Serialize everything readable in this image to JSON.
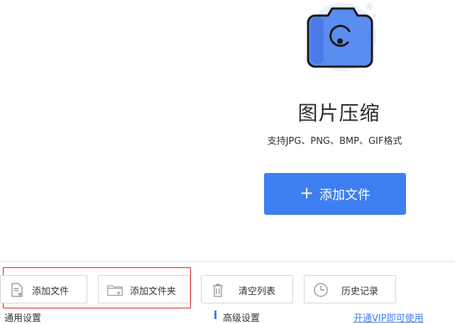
{
  "header": {
    "title": "图片压缩",
    "formats_text": "支持JPG、PNG、BMP、GIF格式",
    "illustration_icon": "camera-icon"
  },
  "primary_action": {
    "label": "添加文件",
    "icon": "plus-icon"
  },
  "toolbar": {
    "add_file": "添加文件",
    "add_folder": "添加文件夹",
    "clear_list": "清空列表",
    "history": "历史记录"
  },
  "sections": {
    "general": "通用设置",
    "advanced": "高级设置",
    "vip_link": "开通VIP即可使用"
  },
  "colors": {
    "accent": "#3d7ff0",
    "highlight": "#e02020",
    "camera_dark": "#1a1a1a",
    "bubble": "#e8eefc"
  }
}
